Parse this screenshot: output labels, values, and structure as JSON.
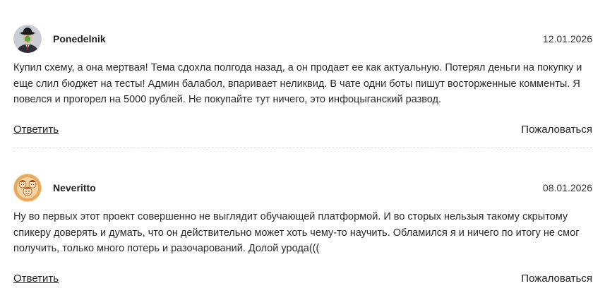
{
  "comments": [
    {
      "author": "Ponedelnik",
      "date": "12.01.2026",
      "avatar": "man-bowler-hat-apple-avatar",
      "text": "Купил схему, а она мертвая! Тема сдохла полгода назад, а он продает ее как актуальную. Потерял деньги на покупку и еще слил бюджет на тесты! Админ балабол, впаривает неликвид. В чате одни боты пишут восторженные комменты. Я повелся и прогорел на 5000 рублей. Не покупайте тут ничего, это инфоцыганский развод.",
      "reply_label": "Ответить",
      "report_label": "Пожаловаться"
    },
    {
      "author": "Neveritto",
      "date": "08.01.2026",
      "avatar": "group-cartoon-avatar",
      "text": "Ну во первых этот проект совершенно не выглядит обучающей платформой. И во сторых нельзыя такому скрытому спикеру доверять и думать, что он действительно может хоть чему-то научить. Обламился я и ничего по итогу не смог получить, только много потерь и разочарований. Долой урода(((",
      "reply_label": "Ответить",
      "report_label": "Пожаловаться"
    }
  ]
}
